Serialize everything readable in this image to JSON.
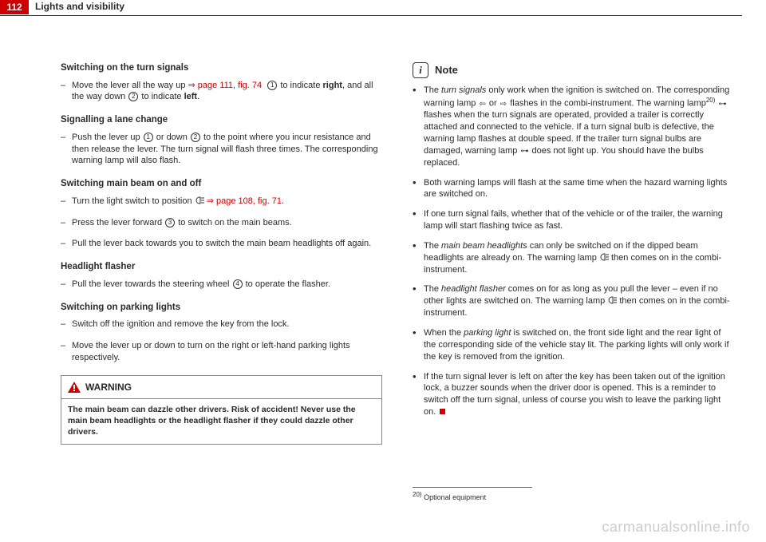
{
  "header": {
    "page_number": "112",
    "section": "Lights and visibility"
  },
  "left": {
    "h_turn": "Switching on the turn signals",
    "turn_item": "Move the lever all the way up ",
    "turn_link": "⇒ page 111, fig. 74",
    "turn_item2": " to indicate ",
    "turn_right": "right",
    "turn_item3": ", and all the way down ",
    "turn_item4": " to indicate ",
    "turn_left": "left",
    "h_lane": "Signalling a lane change",
    "lane_item": "Push the lever up ",
    "lane_item2": " or down ",
    "lane_item3": " to the point where you incur resistance and then release the lever. The turn signal will flash three times. The corresponding warning lamp will also flash.",
    "h_main": "Switching main beam on and off",
    "main_item1a": "Turn the light switch to position ",
    "main_link": "⇒ page 108, fig. 71",
    "main_item2a": "Press the lever forward ",
    "main_item2b": " to switch on the main beams.",
    "main_item3": "Pull the lever back towards you to switch the main beam headlights off again.",
    "h_flash": "Headlight flasher",
    "flash_item1a": "Pull the lever towards the steering wheel ",
    "flash_item1b": " to operate the flasher.",
    "h_park": "Switching on parking lights",
    "park_item1": "Switch off the ignition and remove the key from the lock.",
    "park_item2": "Move the lever up or down to turn on the right or left-hand parking lights respectively.",
    "warning_title": "WARNING",
    "warning_body": "The main beam can dazzle other drivers. Risk of accident! Never use the main beam headlights or the headlight flasher if they could dazzle other drivers."
  },
  "right": {
    "note_title": "Note",
    "b1a": "The ",
    "b1it": "turn signals",
    "b1b": " only work when the ignition is switched on. The corresponding warning lamp ",
    "b1c": " or ",
    "b1d": " flashes in the combi-instrument. The warning lamp",
    "b1fn": "20)",
    "b1e": " flashes when the turn signals are operated, provided a trailer is correctly attached and connected to the vehicle. If a turn signal bulb is defective, the warning lamp flashes at double speed. If the trailer turn signal bulbs are damaged, warning lamp ",
    "b1f": " does not light up. You should have the bulbs replaced.",
    "b2": "Both warning lamps will flash at the same time when the hazard warning lights are switched on.",
    "b3": "If one turn signal fails, whether that of the vehicle or of the trailer, the warning lamp will start flashing twice as fast.",
    "b4a": "The ",
    "b4it": "main beam headlights",
    "b4b": " can only be switched on if the dipped beam headlights are already on. The warning lamp ",
    "b4c": " then comes on in the combi-instrument.",
    "b5a": "The ",
    "b5it": "headlight flasher",
    "b5b": " comes on for as long as you pull the lever – even if no other lights are switched on. The warning lamp ",
    "b5c": " then comes on in the combi-instrument.",
    "b6a": "When the ",
    "b6it": "parking light",
    "b6b": "  is switched on, the front side light and the rear light of the corresponding side of the vehicle stay lit. The parking lights will only work if the key is removed from the ignition.",
    "b7": "If the turn signal lever is left on after the key has been taken out of the ignition lock, a buzzer sounds when the driver door is opened. This is a reminder to switch off the turn signal, unless of course you wish to leave the parking light on.",
    "footnote_num": "20)",
    "footnote": "Optional equipment"
  },
  "watermark": "carmanualsonline.info"
}
